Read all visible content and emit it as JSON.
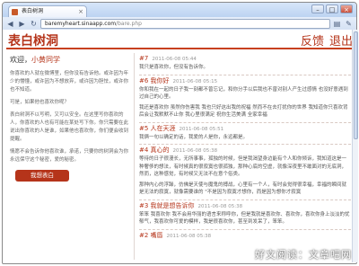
{
  "browser": {
    "tab_title": "表白树洞",
    "url_host": "baremyheart.sinaapp.com",
    "url_path": "/bare.php"
  },
  "site": {
    "logo": "表白树洞",
    "links": {
      "feedback": "反馈",
      "logout": "退出"
    }
  },
  "sidebar": {
    "welcome_prefix": "欢迎，",
    "username": "小黄同学",
    "paragraphs": [
      "你喜欢的人就在微博里，但你没有告诉他。或许因为年少的懵懂，或许因为不想放弃，或许因为胆怯，或许你也不知道。",
      "可是，如果他也喜欢你呢？",
      "表白树洞不以写明，又可以安全。在这里写你喜欢的人，你喜欢的人也有可能在某处写下你。你只需要在此说出你喜欢的人是谁，如果他也喜欢你，你们便会收到提醒。",
      "情愿不会告诉你他喜欢谁，承诺，只要你的树洞会为你永远保守这个秘密，爱的秘密。"
    ],
    "confess_button": "我想表白"
  },
  "posts": [
    {
      "num": "#7",
      "date": "2011-06-08 05:44",
      "body": "我只是喜欢你，但没有告诉你。"
    },
    {
      "num": "#6 我你好",
      "date": "2011-06-08 05:15",
      "body": "你和我在一起的日子我一刻都不曾忘记，和你分手以后我也不曾对别人产生过感情 也没好意遇到过自己的心里。"
    },
    {
      "num": "",
      "date": "",
      "body": "我还是喜欢你 虽然你伤害我 我也只好这出我的祝福 然而不在去打扰你的世界 我知道你只喜欢背后会让我默默不止你 我心里很满足 祝你生活美满 全家幸福"
    },
    {
      "num": "#5 人在天涯",
      "date": "2011-06-08 05:51",
      "body": "我俩一句以确定的话，我爱的人是你，永远都是。"
    },
    {
      "num": "#4 真心的",
      "date": "2011-06-08 05:38",
      "body": "等待的日子很漫长，无所事事，孤独的时候，但是我渴望身边能有个人和你倾诉，我知道这是一种奢侈的想法，有时候真的很寂寞也很孤独，那种心底的空虚，就像深夜里不敢面对的无底洞，然而，这种感觉，有时候又无法不在意个俗类。"
    },
    {
      "num": "",
      "date": "",
      "body": "那种内心的浮躁，仿佛是天使与魔鬼的搏战，心里有一个人，有时会觉得很幸福，幸福的瞬间就是无法的寂寞，就像需要谁的 \"不是因为寂寞才想你，而是因为想你才寂寞"
    },
    {
      "num": "#3 我就是想告诉你",
      "date": "2011-06-08 05:38",
      "body": "笨笨 我喜欢你 我不会用华丽的语言来称呼你，但是我就是喜欢你、喜欢你，喜欢你身上淡淡的忧郁气，我喜欢你可爱的模样，我是很喜欢你，甚至到发呆了，笨笨。"
    },
    {
      "num": "#2 嘴唇",
      "date": "2011-06-08 05:38",
      "body": ""
    }
  ],
  "watermark": "好文阅读：文章吧网"
}
